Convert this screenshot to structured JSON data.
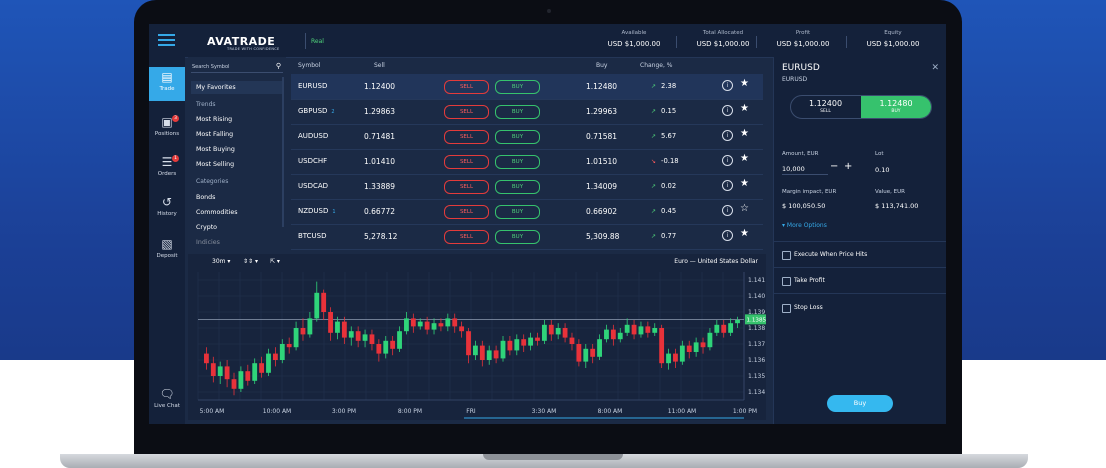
{
  "brand": {
    "name": "AVATRADE",
    "tagline": "TRADE WITH CONFIDENCE",
    "account_type": "Real"
  },
  "stats": [
    {
      "label": "Available",
      "value": "USD $1,000.00"
    },
    {
      "label": "Total Allocated",
      "value": "USD $1,000.00"
    },
    {
      "label": "Profit",
      "value": "USD $1,000.00"
    },
    {
      "label": "Equity",
      "value": "USD $1,000.00"
    }
  ],
  "nav": [
    {
      "label": "Trade",
      "icon": "chart-icon"
    },
    {
      "label": "Positions",
      "icon": "briefcase-icon",
      "badge": "3"
    },
    {
      "label": "Orders",
      "icon": "list-icon",
      "badge": "1"
    },
    {
      "label": "History",
      "icon": "history-icon"
    },
    {
      "label": "Deposit",
      "icon": "deposit-icon"
    },
    {
      "label": "Live Chat",
      "icon": "chat-icon"
    }
  ],
  "symbol_list": {
    "search_placeholder": "Search Symbol",
    "favorites": "My Favorites",
    "trends_header": "Trends",
    "trends": [
      "Most Rising",
      "Most Falling",
      "Most Buying",
      "Most Selling"
    ],
    "categories_header": "Categories",
    "categories": [
      "Bonds",
      "Commodities",
      "Crypto",
      "Indicies"
    ]
  },
  "table": {
    "headers": {
      "symbol": "Symbol",
      "sell": "Sell",
      "buy": "Buy",
      "change": "Change, %"
    },
    "sell_label": "SELL",
    "buy_label": "BUY",
    "rows": [
      {
        "symbol": "EURUSD",
        "count": "",
        "sell": "1.12400",
        "buy": "1.12480",
        "change": "2.38",
        "dir": "up",
        "fav": true
      },
      {
        "symbol": "GBPUSD",
        "count": "2",
        "sell": "1.29863",
        "buy": "1.29963",
        "change": "0.15",
        "dir": "up",
        "fav": true
      },
      {
        "symbol": "AUDUSD",
        "count": "",
        "sell": "0.71481",
        "buy": "0.71581",
        "change": "5.67",
        "dir": "up",
        "fav": true
      },
      {
        "symbol": "USDCHF",
        "count": "",
        "sell": "1.01410",
        "buy": "1.01510",
        "change": "-0.18",
        "dir": "down",
        "fav": true
      },
      {
        "symbol": "USDCAD",
        "count": "",
        "sell": "1.33889",
        "buy": "1.34009",
        "change": "0.02",
        "dir": "up",
        "fav": true
      },
      {
        "symbol": "NZDUSD",
        "count": "1",
        "sell": "0.66772",
        "buy": "0.66902",
        "change": "0.45",
        "dir": "up",
        "fav": false
      },
      {
        "symbol": "BTCUSD",
        "count": "",
        "sell": "5,278.12",
        "buy": "5,309.88",
        "change": "0.77",
        "dir": "up",
        "fav": true
      }
    ]
  },
  "chart": {
    "timeframe": "30m",
    "title": "Euro — United States Dollar",
    "current_price": "1.13854"
  },
  "chart_data": {
    "type": "candlestick",
    "title": "Euro — United States Dollar",
    "y_ticks": [
      1.141,
      1.14,
      1.139,
      1.138,
      1.137,
      1.136,
      1.135,
      1.134
    ],
    "ylim": [
      1.1335,
      1.1415
    ],
    "current_price": 1.13854,
    "x_ticks": [
      "5:00 AM",
      "10:00 AM",
      "3:00 PM",
      "8:00 PM",
      "FRI",
      "3:30 AM",
      "8:00 AM",
      "11:00 AM",
      "1:00 PM"
    ],
    "candles": [
      [
        1.1364,
        1.1358,
        1.1368,
        1.1354
      ],
      [
        1.1358,
        1.135,
        1.1362,
        1.1346
      ],
      [
        1.135,
        1.1356,
        1.1359,
        1.1345
      ],
      [
        1.1356,
        1.1348,
        1.136,
        1.1343
      ],
      [
        1.1348,
        1.1342,
        1.1352,
        1.1338
      ],
      [
        1.1342,
        1.1353,
        1.1356,
        1.134
      ],
      [
        1.1353,
        1.1347,
        1.1357,
        1.1344
      ],
      [
        1.1347,
        1.1358,
        1.1361,
        1.1345
      ],
      [
        1.1358,
        1.1352,
        1.1362,
        1.1349
      ],
      [
        1.1352,
        1.1364,
        1.1367,
        1.135
      ],
      [
        1.1364,
        1.136,
        1.1368,
        1.1356
      ],
      [
        1.136,
        1.137,
        1.1373,
        1.1358
      ],
      [
        1.137,
        1.1368,
        1.1374,
        1.1364
      ],
      [
        1.1368,
        1.138,
        1.1384,
        1.1366
      ],
      [
        1.138,
        1.1376,
        1.1386,
        1.1372
      ],
      [
        1.1376,
        1.1386,
        1.139,
        1.1374
      ],
      [
        1.1386,
        1.1402,
        1.1409,
        1.1384
      ],
      [
        1.1402,
        1.139,
        1.1404,
        1.1385
      ],
      [
        1.139,
        1.1377,
        1.1393,
        1.1372
      ],
      [
        1.1377,
        1.1384,
        1.1387,
        1.1373
      ],
      [
        1.1384,
        1.1374,
        1.1387,
        1.137
      ],
      [
        1.1374,
        1.1378,
        1.1381,
        1.1369
      ],
      [
        1.1378,
        1.1372,
        1.1381,
        1.1368
      ],
      [
        1.1372,
        1.1376,
        1.1379,
        1.1368
      ],
      [
        1.1376,
        1.137,
        1.1379,
        1.1366
      ],
      [
        1.137,
        1.1364,
        1.1373,
        1.1359
      ],
      [
        1.1364,
        1.1372,
        1.1375,
        1.1361
      ],
      [
        1.1372,
        1.1367,
        1.1375,
        1.1363
      ],
      [
        1.1367,
        1.1378,
        1.1381,
        1.1365
      ],
      [
        1.1378,
        1.1386,
        1.139,
        1.1376
      ],
      [
        1.1386,
        1.1381,
        1.1389,
        1.1377
      ],
      [
        1.1381,
        1.1384,
        1.1386,
        1.1379
      ],
      [
        1.1384,
        1.1379,
        1.1387,
        1.1376
      ],
      [
        1.1379,
        1.1383,
        1.1386,
        1.1376
      ],
      [
        1.1383,
        1.1381,
        1.1386,
        1.1378
      ],
      [
        1.1381,
        1.1386,
        1.1389,
        1.1378
      ],
      [
        1.1386,
        1.1381,
        1.1389,
        1.1377
      ],
      [
        1.1381,
        1.1378,
        1.1384,
        1.1374
      ],
      [
        1.1378,
        1.1363,
        1.138,
        1.1358
      ],
      [
        1.1363,
        1.1369,
        1.1372,
        1.136
      ],
      [
        1.1369,
        1.136,
        1.1372,
        1.1356
      ],
      [
        1.136,
        1.1366,
        1.1369,
        1.1357
      ],
      [
        1.1366,
        1.1361,
        1.1369,
        1.1358
      ],
      [
        1.1361,
        1.1372,
        1.1375,
        1.1359
      ],
      [
        1.1372,
        1.1366,
        1.1375,
        1.1363
      ],
      [
        1.1366,
        1.1373,
        1.1376,
        1.1363
      ],
      [
        1.1373,
        1.1369,
        1.1376,
        1.1365
      ],
      [
        1.1369,
        1.1374,
        1.1377,
        1.1366
      ],
      [
        1.1374,
        1.1372,
        1.1377,
        1.1369
      ],
      [
        1.1372,
        1.1382,
        1.1385,
        1.137
      ],
      [
        1.1382,
        1.1376,
        1.1385,
        1.1372
      ],
      [
        1.1376,
        1.138,
        1.1383,
        1.1373
      ],
      [
        1.138,
        1.1374,
        1.1383,
        1.1371
      ],
      [
        1.1374,
        1.137,
        1.1377,
        1.1366
      ],
      [
        1.137,
        1.1359,
        1.1373,
        1.1356
      ],
      [
        1.1359,
        1.1367,
        1.137,
        1.1355
      ],
      [
        1.1367,
        1.1362,
        1.137,
        1.1358
      ],
      [
        1.1362,
        1.1373,
        1.1376,
        1.136
      ],
      [
        1.1373,
        1.1379,
        1.1382,
        1.1371
      ],
      [
        1.1379,
        1.1373,
        1.1382,
        1.1369
      ],
      [
        1.1373,
        1.1377,
        1.138,
        1.1371
      ],
      [
        1.1377,
        1.1382,
        1.1386,
        1.1375
      ],
      [
        1.1382,
        1.1376,
        1.1385,
        1.1373
      ],
      [
        1.1376,
        1.1381,
        1.1384,
        1.1374
      ],
      [
        1.1381,
        1.1377,
        1.1384,
        1.1374
      ],
      [
        1.1377,
        1.138,
        1.1383,
        1.1375
      ],
      [
        1.138,
        1.1358,
        1.1382,
        1.1355
      ],
      [
        1.1358,
        1.1364,
        1.1367,
        1.1354
      ],
      [
        1.1364,
        1.1359,
        1.1367,
        1.1355
      ],
      [
        1.1359,
        1.1369,
        1.1372,
        1.1357
      ],
      [
        1.1369,
        1.1365,
        1.1372,
        1.1361
      ],
      [
        1.1365,
        1.1371,
        1.1374,
        1.1362
      ],
      [
        1.1371,
        1.1368,
        1.1374,
        1.1364
      ],
      [
        1.1368,
        1.1377,
        1.138,
        1.1366
      ],
      [
        1.1377,
        1.1382,
        1.1385,
        1.1375
      ],
      [
        1.1382,
        1.1377,
        1.1385,
        1.1374
      ],
      [
        1.1377,
        1.1383,
        1.1386,
        1.1375
      ],
      [
        1.1383,
        1.1385,
        1.1387,
        1.138
      ]
    ]
  },
  "order_panel": {
    "symbol": "EURUSD",
    "sub": "EURUSD",
    "sell_price": "1.12400",
    "sell_label": "SELL",
    "buy_price": "1.12480",
    "buy_label": "BUY",
    "amount_label": "Amount, EUR",
    "amount_value": "10,000",
    "lot_label": "Lot",
    "lot_value": "0.10",
    "margin_label": "Margin impact, EUR",
    "margin_value": "$ 100,050.50",
    "value_label": "Value, EUR",
    "value_value": "$ 113,741.00",
    "more_options": "More Options",
    "options": [
      "Execute When Price Hits",
      "Take Profit",
      "Stop Loss"
    ],
    "buy_button": "Buy"
  }
}
